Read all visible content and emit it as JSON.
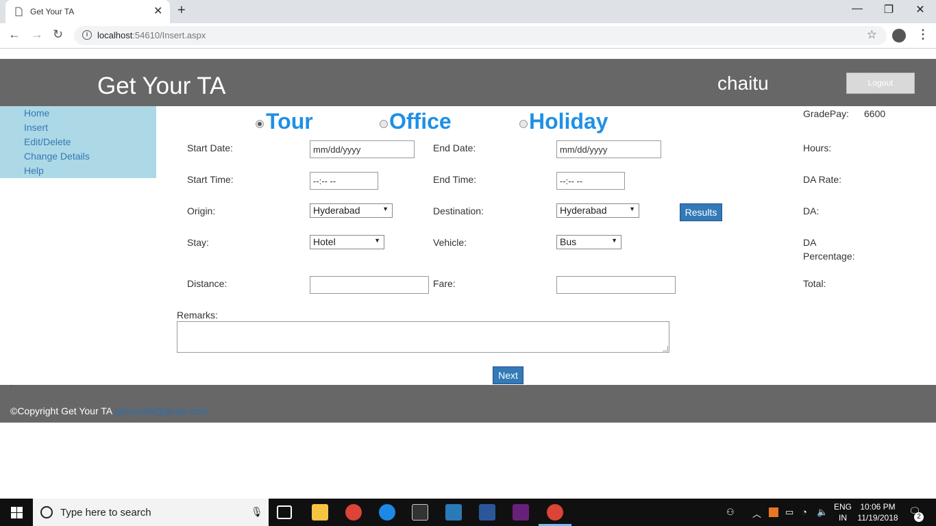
{
  "browser": {
    "tab_title": "Get Your TA",
    "url_host": "localhost",
    "url_rest": ":54610/Insert.aspx"
  },
  "header": {
    "brand": "Get Your TA",
    "username": "chaitu",
    "logout_label": "Logout"
  },
  "sidebar": {
    "items": [
      {
        "label": "Home"
      },
      {
        "label": "Insert"
      },
      {
        "label": "Edit/Delete"
      },
      {
        "label": "Change Details"
      },
      {
        "label": "Help"
      }
    ]
  },
  "trip_type": {
    "options": [
      {
        "label": "Tour",
        "selected": true
      },
      {
        "label": "Office",
        "selected": false
      },
      {
        "label": "Holiday",
        "selected": false
      }
    ]
  },
  "form": {
    "start_date_label": "Start Date:",
    "start_date_placeholder": "mm/dd/yyyy",
    "end_date_label": "End Date:",
    "end_date_placeholder": "mm/dd/yyyy",
    "start_time_label": "Start Time:",
    "start_time_placeholder": "--:-- --",
    "end_time_label": "End Time:",
    "end_time_placeholder": "--:-- --",
    "origin_label": "Origin:",
    "origin_value": "Hyderabad",
    "destination_label": "Destination:",
    "destination_value": "Hyderabad",
    "results_label": "Results",
    "stay_label": "Stay:",
    "stay_value": "Hotel",
    "vehicle_label": "Vehicle:",
    "vehicle_value": "Bus",
    "distance_label": "Distance:",
    "distance_value": "",
    "fare_label": "Fare:",
    "fare_value": "",
    "remarks_label": "Remarks:",
    "remarks_value": "",
    "next_label": "Next"
  },
  "info": {
    "gradepay_label": "GradePay:",
    "gradepay_value": "6600",
    "hours_label": "Hours:",
    "da_rate_label": "DA Rate:",
    "da_label": "DA:",
    "da_percentage_line1": "DA",
    "da_percentage_line2": "Percentage:",
    "total_label": "Total:"
  },
  "footer": {
    "copyright": "©Copyright Get Your TA",
    "email": "getyourta@gmail.com",
    "tick": "`"
  },
  "taskbar": {
    "search_placeholder": "Type here to search",
    "lang_top": "ENG",
    "lang_bottom": "IN",
    "time": "10:06 PM",
    "date": "11/19/2018",
    "notification_count": "2"
  },
  "colors": {
    "header_bg": "#676767",
    "sidebar_bg": "#add8e6",
    "link": "#337ab7",
    "radio_label": "#1e90e6",
    "button": "#337ab7"
  }
}
